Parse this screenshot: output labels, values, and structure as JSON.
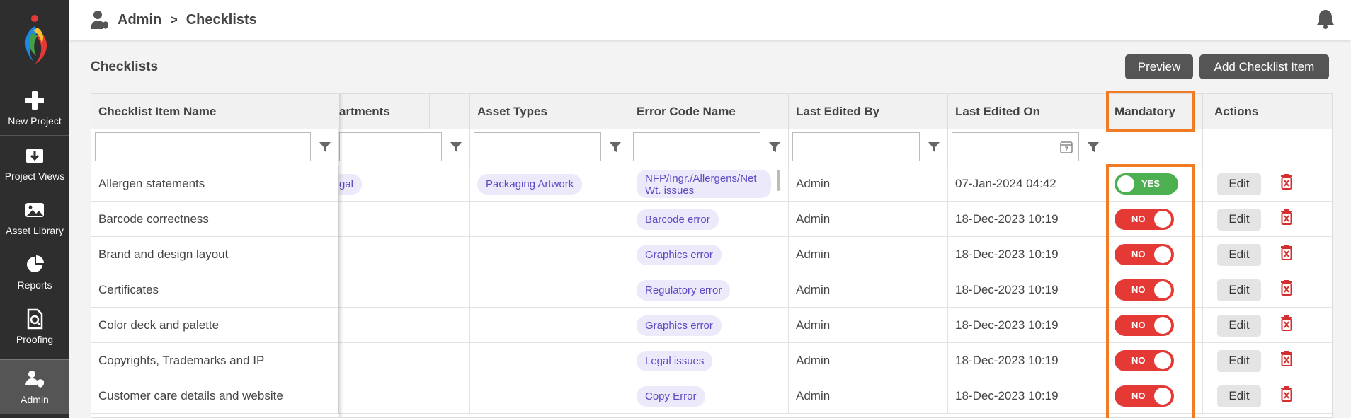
{
  "sidebar": {
    "items": [
      {
        "label": "New Project",
        "icon": "plus-icon"
      },
      {
        "label": "Project Views",
        "icon": "download-box-icon"
      },
      {
        "label": "Asset Library",
        "icon": "image-icon"
      },
      {
        "label": "Reports",
        "icon": "pie-chart-icon"
      },
      {
        "label": "Proofing",
        "icon": "proof-search-icon"
      },
      {
        "label": "Admin",
        "icon": "admin-user-icon"
      }
    ]
  },
  "header": {
    "breadcrumb_root": "Admin",
    "breadcrumb_sep": ">",
    "breadcrumb_current": "Checklists"
  },
  "page": {
    "title": "Checklists",
    "preview_label": "Preview",
    "add_label": "Add Checklist Item"
  },
  "table": {
    "columns": {
      "name": "Checklist Item Name",
      "departments": "artments",
      "asset_types": "Asset Types",
      "error_code": "Error Code Name",
      "edited_by": "Last Edited By",
      "edited_on": "Last Edited On",
      "mandatory": "Mandatory",
      "actions": "Actions"
    },
    "edit_label": "Edit",
    "rows": [
      {
        "name": "Allergen statements",
        "department": "gal",
        "asset_type": "Packaging Artwork",
        "error_code": "NFP/Ingr./Allergens/Net Wt. issues",
        "edited_by": "Admin",
        "edited_on": "07-Jan-2024 04:42",
        "mandatory": "YES"
      },
      {
        "name": "Barcode correctness",
        "department": "",
        "asset_type": "",
        "error_code": "Barcode error",
        "edited_by": "Admin",
        "edited_on": "18-Dec-2023 10:19",
        "mandatory": "NO"
      },
      {
        "name": "Brand and design layout",
        "department": "",
        "asset_type": "",
        "error_code": "Graphics error",
        "edited_by": "Admin",
        "edited_on": "18-Dec-2023 10:19",
        "mandatory": "NO"
      },
      {
        "name": "Certificates",
        "department": "",
        "asset_type": "",
        "error_code": "Regulatory error",
        "edited_by": "Admin",
        "edited_on": "18-Dec-2023 10:19",
        "mandatory": "NO"
      },
      {
        "name": "Color deck and palette",
        "department": "",
        "asset_type": "",
        "error_code": "Graphics error",
        "edited_by": "Admin",
        "edited_on": "18-Dec-2023 10:19",
        "mandatory": "NO"
      },
      {
        "name": "Copyrights, Trademarks and IP",
        "department": "",
        "asset_type": "",
        "error_code": "Legal issues",
        "edited_by": "Admin",
        "edited_on": "18-Dec-2023 10:19",
        "mandatory": "NO"
      },
      {
        "name": "Customer care details and website",
        "department": "",
        "asset_type": "",
        "error_code": "Copy Error",
        "edited_by": "Admin",
        "edited_on": "18-Dec-2023 10:19",
        "mandatory": "NO"
      }
    ]
  },
  "colors": {
    "sidebar": "#2e2e2e",
    "toggle_no": "#e53935",
    "toggle_yes": "#4caf50",
    "highlight": "#f07b22",
    "delete": "#d32f2f",
    "tag_bg": "#ece9fb",
    "tag_text": "#5b4bc4"
  }
}
